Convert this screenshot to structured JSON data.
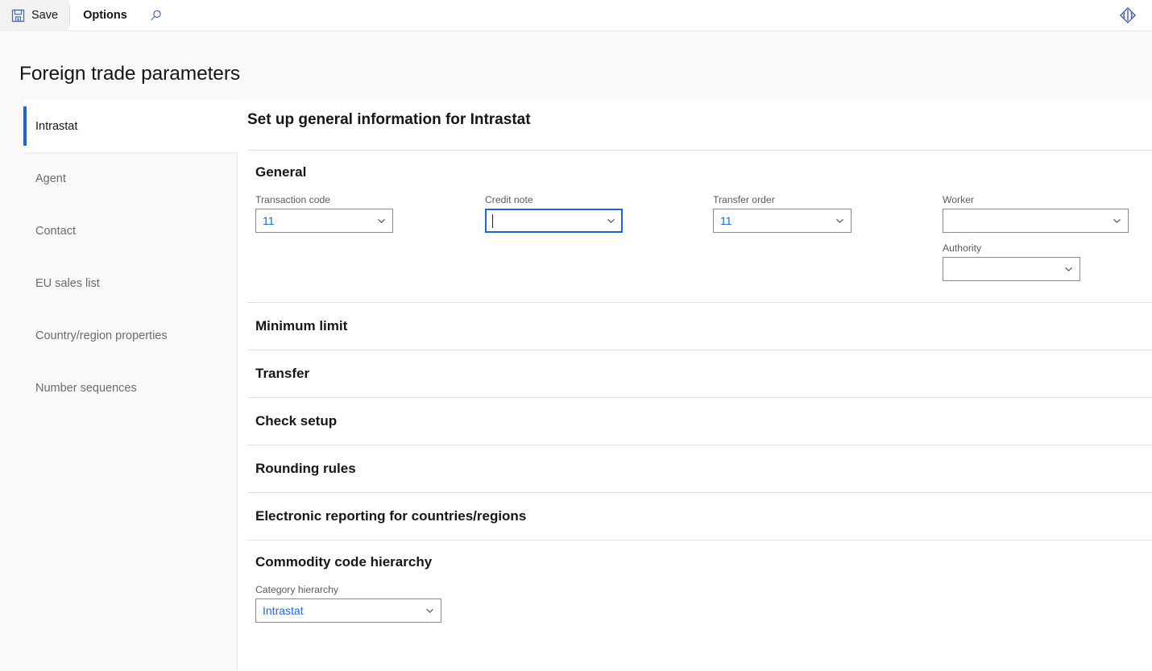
{
  "toolbar": {
    "save_label": "Save",
    "save_icon": "floppy-disk-icon",
    "options_label": "Options",
    "search_icon": "search-icon",
    "diamond_icon": "diamond-icon"
  },
  "header": {
    "page_title": "Foreign trade parameters"
  },
  "sidebar": {
    "items": [
      {
        "label": "Intrastat",
        "active": true
      },
      {
        "label": "Agent",
        "active": false
      },
      {
        "label": "Contact",
        "active": false
      },
      {
        "label": "EU sales list",
        "active": false
      },
      {
        "label": "Country/region properties",
        "active": false
      },
      {
        "label": "Number sequences",
        "active": false
      }
    ]
  },
  "content": {
    "title": "Set up general information for Intrastat",
    "sections": {
      "general": {
        "title": "General",
        "fields": {
          "transaction_code": {
            "label": "Transaction code",
            "value": "11",
            "placeholder": ""
          },
          "credit_note": {
            "label": "Credit note",
            "value": "",
            "placeholder": ""
          },
          "transfer_order": {
            "label": "Transfer order",
            "value": "11",
            "placeholder": ""
          },
          "worker": {
            "label": "Worker",
            "value": "",
            "placeholder": ""
          },
          "authority": {
            "label": "Authority",
            "value": "",
            "placeholder": ""
          }
        }
      },
      "minimum_limit": {
        "title": "Minimum limit"
      },
      "transfer": {
        "title": "Transfer"
      },
      "check_setup": {
        "title": "Check setup"
      },
      "rounding_rules": {
        "title": "Rounding rules"
      },
      "electronic_reporting": {
        "title": "Electronic reporting for countries/regions"
      },
      "commodity_code_hierarchy": {
        "title": "Commodity code hierarchy",
        "fields": {
          "category_hierarchy": {
            "label": "Category hierarchy",
            "value": "Intrastat",
            "placeholder": ""
          }
        }
      }
    }
  },
  "colors": {
    "accent": "#2266cc",
    "page_bg": "#faf9f8",
    "content_bg": "#ffffff",
    "border": "#e1dfdd",
    "field_border": "#8a8886",
    "text_primary": "#161616",
    "text_secondary": "#6b6b6b"
  }
}
